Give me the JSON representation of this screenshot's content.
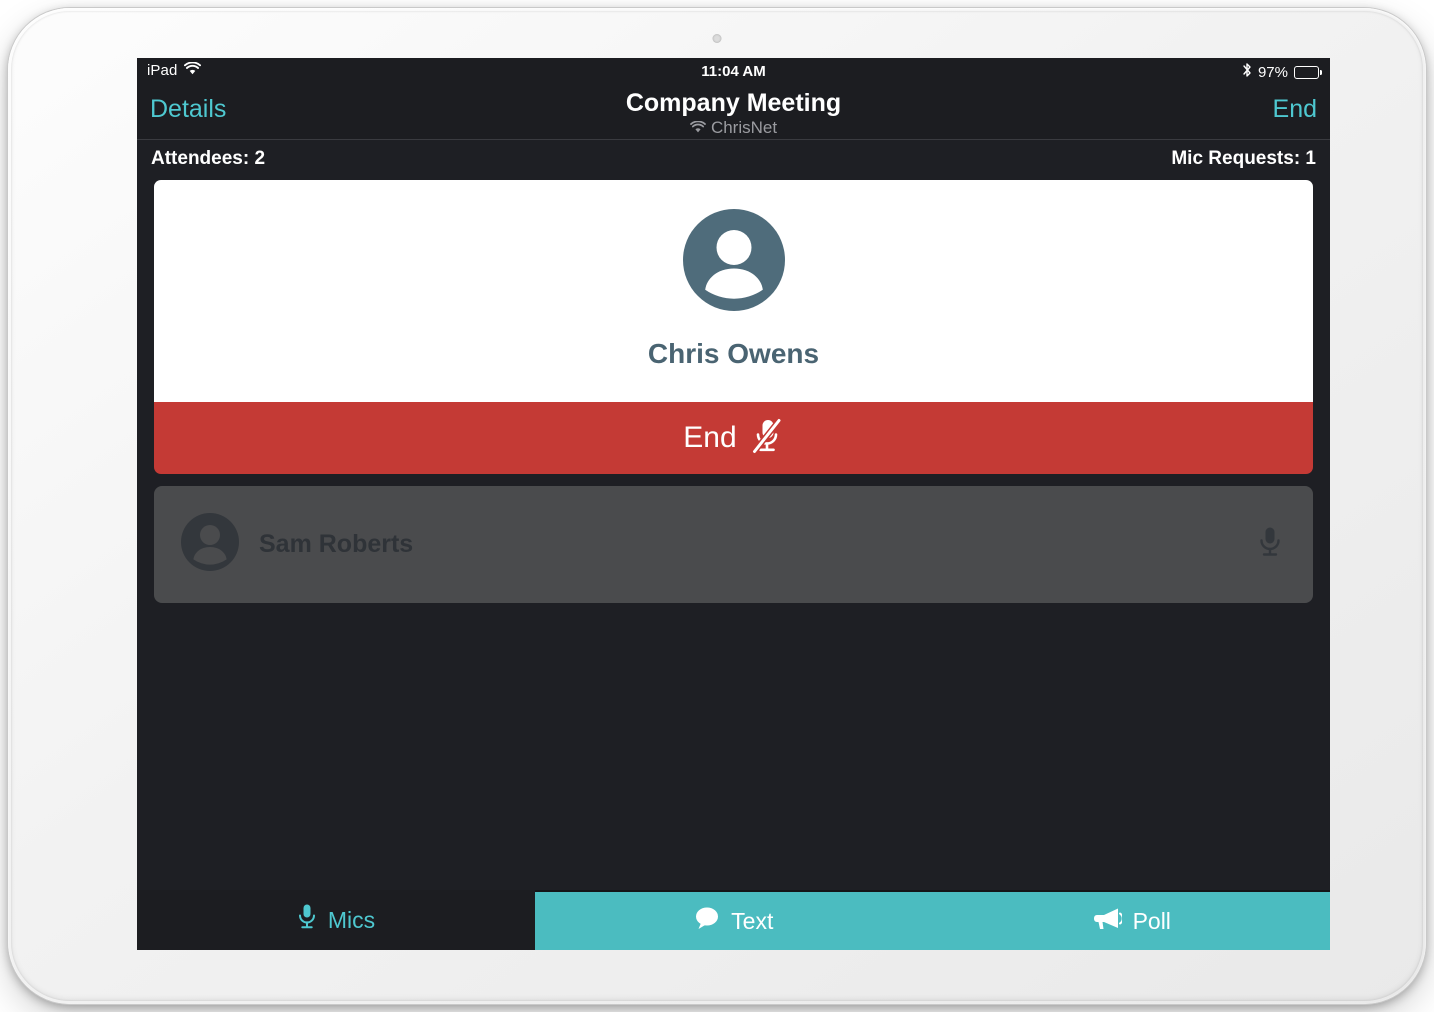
{
  "device": {
    "kind": "ipad",
    "bezel_color": "#f1f1f1"
  },
  "status_bar": {
    "device_label": "iPad",
    "wifi_icon": "wifi-icon",
    "time": "11:04 AM",
    "bluetooth_icon": "bluetooth-icon",
    "battery_percent": "97%",
    "battery_icon": "battery-full-icon"
  },
  "nav_bar": {
    "left_button": "Details",
    "title": "Company Meeting",
    "subtitle": "ChrisNet",
    "subtitle_icon": "wifi-icon",
    "right_button": "End"
  },
  "info_bar": {
    "attendees": "Attendees: 2",
    "mic_requests": "Mic Requests: 1"
  },
  "speaker": {
    "avatar_icon": "person-avatar-icon",
    "name": "Chris Owens",
    "end_button": {
      "label": "End",
      "icon": "microphone-muted-icon",
      "color": "#c43a35"
    }
  },
  "attendees": [
    {
      "avatar_icon": "person-avatar-icon",
      "name": "Sam Roberts",
      "mic_icon": "microphone-icon"
    }
  ],
  "toolbar": {
    "tabs": [
      {
        "label": "Mics",
        "icon": "microphone-icon",
        "active": false
      },
      {
        "label": "Text",
        "icon": "speech-bubble-icon",
        "active": true
      },
      {
        "label": "Poll",
        "icon": "megaphone-icon",
        "active": true
      }
    ]
  },
  "colors": {
    "accent_teal": "#4bbcc0",
    "nav_teal": "#4ec8d0",
    "danger_red": "#c43a35",
    "screen_bg": "#1e1f24",
    "bar_bg": "#1c1d21",
    "row_gray": "#4a4b4d",
    "avatar_slate": "#4f6c7b"
  }
}
